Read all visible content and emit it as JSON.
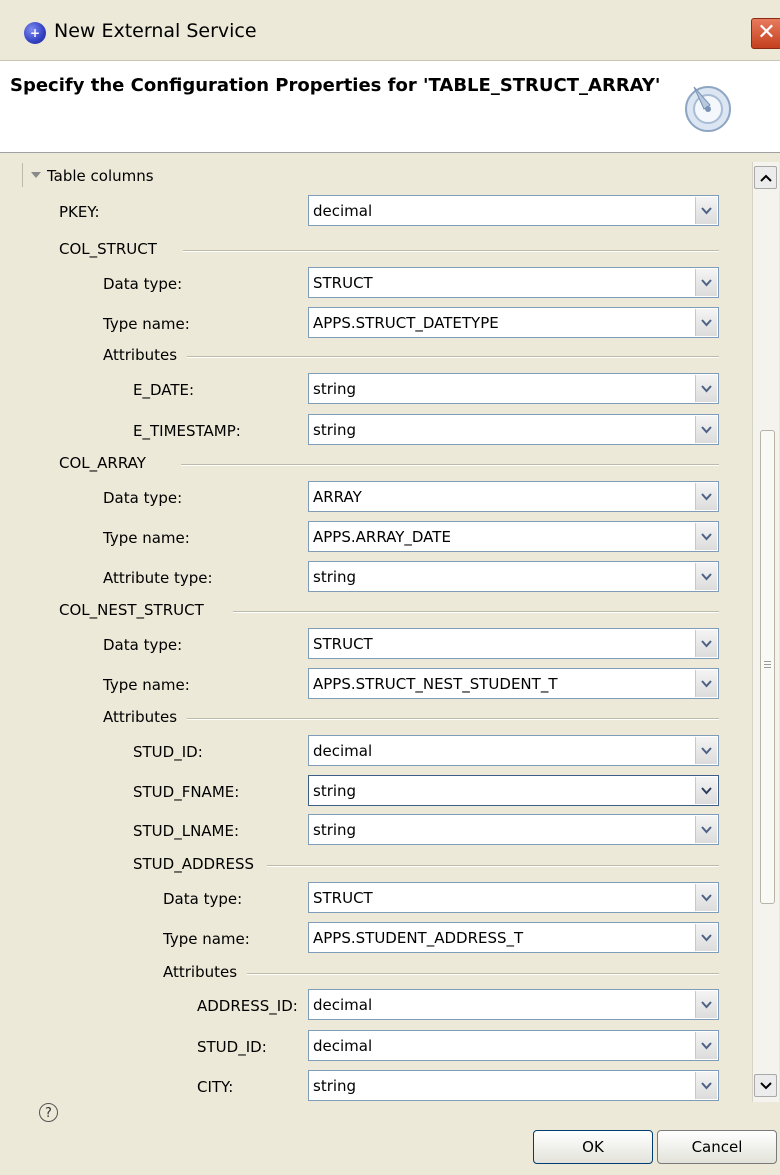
{
  "window": {
    "title": "New External Service",
    "close_glyph": "✕",
    "app_icon": "wizard-app-icon"
  },
  "header": {
    "title": "Specify the Configuration Properties for 'TABLE_STRUCT_ARRAY'",
    "icon": "wizard-banner-icon"
  },
  "section": {
    "label": "Table columns"
  },
  "pkey": {
    "label": "PKEY:",
    "value": "decimal"
  },
  "col_struct": {
    "label": "COL_STRUCT",
    "data_type": {
      "label": "Data type:",
      "value": "STRUCT"
    },
    "type_name": {
      "label": "Type name:",
      "value": "APPS.STRUCT_DATETYPE"
    },
    "attributes_label": "Attributes",
    "e_date": {
      "label": "E_DATE:",
      "value": "string"
    },
    "e_timestamp": {
      "label": "E_TIMESTAMP:",
      "value": "string"
    }
  },
  "col_array": {
    "label": "COL_ARRAY",
    "data_type": {
      "label": "Data type:",
      "value": "ARRAY"
    },
    "type_name": {
      "label": "Type name:",
      "value": "APPS.ARRAY_DATE"
    },
    "attribute_type": {
      "label": "Attribute type:",
      "value": "string"
    }
  },
  "col_nest_struct": {
    "label": "COL_NEST_STRUCT",
    "data_type": {
      "label": "Data type:",
      "value": "STRUCT"
    },
    "type_name": {
      "label": "Type name:",
      "value": "APPS.STRUCT_NEST_STUDENT_T"
    },
    "attributes_label": "Attributes",
    "stud_id": {
      "label": "STUD_ID:",
      "value": "decimal"
    },
    "stud_fname": {
      "label": "STUD_FNAME:",
      "value": "string"
    },
    "stud_lname": {
      "label": "STUD_LNAME:",
      "value": "string"
    },
    "stud_address": {
      "label": "STUD_ADDRESS",
      "data_type": {
        "label": "Data type:",
        "value": "STRUCT"
      },
      "type_name": {
        "label": "Type name:",
        "value": "APPS.STUDENT_ADDRESS_T"
      },
      "attributes_label": "Attributes",
      "address_id": {
        "label": "ADDRESS_ID:",
        "value": "decimal"
      },
      "stud_id": {
        "label": "STUD_ID:",
        "value": "decimal"
      },
      "city": {
        "label": "CITY:",
        "value": "string"
      }
    }
  },
  "footer": {
    "help_glyph": "?",
    "ok_label": "OK",
    "cancel_label": "Cancel"
  }
}
